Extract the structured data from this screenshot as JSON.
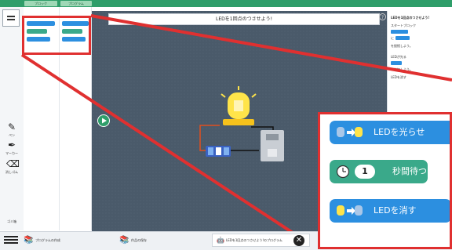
{
  "top_tabs": [
    "ブロック",
    "プログラム"
  ],
  "canvas": {
    "title": "LEDを1回点のつさせよう!"
  },
  "rail": {
    "tools": [
      {
        "icon": "✎",
        "label": "ペン"
      },
      {
        "icon": "✒",
        "label": "マーカー"
      },
      {
        "icon": "⌫",
        "label": "消しゴム"
      }
    ],
    "bottom_label": "ゴミ箱"
  },
  "right_panel": {
    "heading": "LEDを1回点のつさせよう!",
    "lines": [
      "スタートブロック",
      "に",
      "を接続しよう。",
      "LEDが光る",
      "を追加しよう。",
      "LEDを消す"
    ]
  },
  "bottom_tabs": [
    {
      "label": "プログラムの作成",
      "icon": "books-icon"
    },
    {
      "label": "作品の保存",
      "icon": "books-icon"
    },
    {
      "label": "LEDを1回点のつさせよう!のプログラム",
      "icon": "robot-icon"
    }
  ],
  "zoom_blocks": [
    {
      "label": "LEDを光らせ",
      "color": "#2c8fe0"
    },
    {
      "label": "秒間待つ",
      "color": "#3aa98a",
      "number": "1"
    },
    {
      "label": "LEDを消す",
      "color": "#2c8fe0"
    }
  ],
  "colors": {
    "accent_green": "#2f9e6a",
    "block_blue": "#2c8fe0",
    "block_teal": "#3aa98a",
    "highlight_red": "#e03030"
  }
}
